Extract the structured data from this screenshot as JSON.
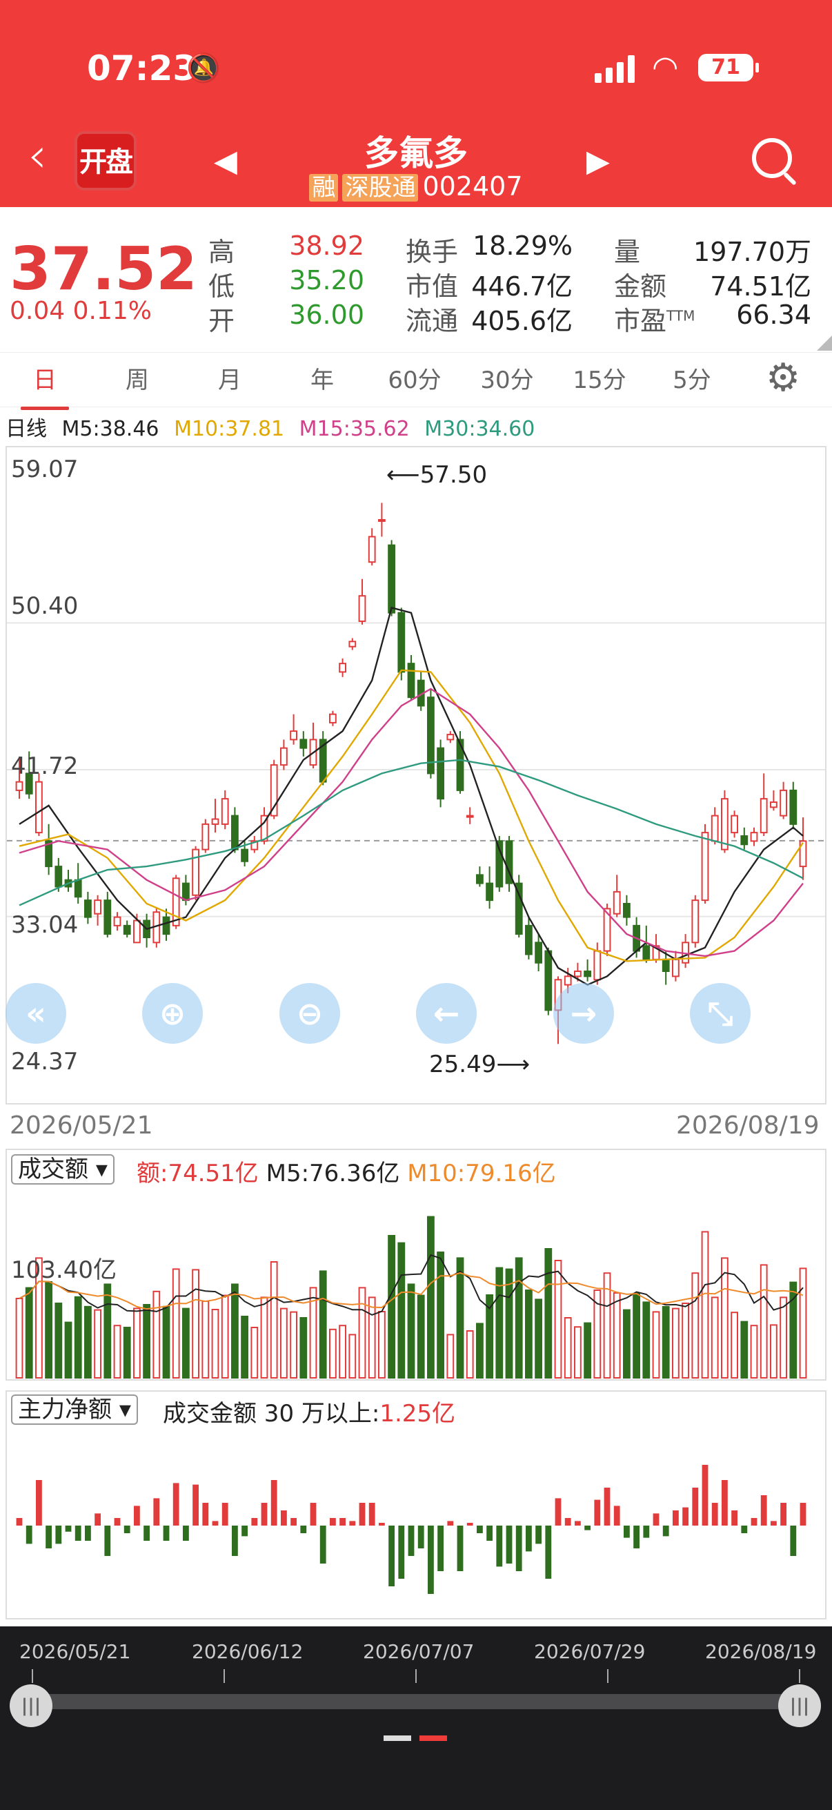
{
  "status_bar": {
    "time": "07:23",
    "battery": "71"
  },
  "header": {
    "kaipan_label": "开盘",
    "stock_name": "多氟多",
    "tag_margin": "融",
    "tag_connect": "深股通",
    "stock_code": "002407"
  },
  "quote": {
    "price": "37.52",
    "change": "0.04",
    "change_pct": "0.11%",
    "fields": [
      {
        "label": "高",
        "value": "38.92",
        "color": "#e13b3b"
      },
      {
        "label": "低",
        "value": "35.20",
        "color": "#2e9a2e"
      },
      {
        "label": "开",
        "value": "36.00",
        "color": "#2e9a2e"
      },
      {
        "label": "换手",
        "value": "18.29%"
      },
      {
        "label": "市值",
        "value": "446.7亿"
      },
      {
        "label": "流通",
        "value": "405.6亿"
      },
      {
        "label": "量",
        "value": "197.70万"
      },
      {
        "label": "金额",
        "value": "74.51亿"
      },
      {
        "label": "市盈",
        "sup": "TTM",
        "value": "66.34"
      }
    ]
  },
  "tabs": [
    "日",
    "周",
    "月",
    "年",
    "60分",
    "30分",
    "15分",
    "5分"
  ],
  "ma_legend": {
    "name": "日线",
    "m5": "M5:38.46",
    "m10": "M10:37.81",
    "m15": "M15:35.62",
    "m30": "M30:34.60",
    "colors": {
      "m5": "#222222",
      "m10": "#e0a800",
      "m15": "#d0408a",
      "m30": "#2e9a7e"
    }
  },
  "price_chart": {
    "y_labels": [
      "59.07",
      "50.40",
      "41.72",
      "33.04",
      "24.37"
    ],
    "high_annot": "57.50",
    "low_annot": "25.49",
    "start_date": "2026/05/21",
    "end_date": "2026/08/19",
    "controls": [
      "«",
      "⊕",
      "⊖",
      "←",
      "→",
      "⤡"
    ]
  },
  "volume_panel": {
    "selector": "成交额",
    "amount": "额:74.51亿",
    "m5": "M5:76.36亿",
    "m10": "M10:79.16亿",
    "y_label": "103.40亿"
  },
  "flow_panel": {
    "selector": "主力净额",
    "label": "成交金额 30 万以上:",
    "value": "1.25亿"
  },
  "scroller": {
    "dates": [
      "2026/05/21",
      "2026/06/12",
      "2026/07/07",
      "2026/07/29",
      "2026/08/19"
    ]
  },
  "chart_data": {
    "type": "candlestick",
    "y_range": [
      24.37,
      59.07
    ],
    "candles": [
      [
        40.5,
        41.0,
        42.5,
        40.0
      ],
      [
        41.5,
        40.3,
        42.8,
        40.0
      ],
      [
        38.0,
        41.0,
        41.5,
        37.8
      ],
      [
        37.5,
        36.0,
        38.5,
        35.5
      ],
      [
        36.0,
        34.8,
        36.5,
        34.5
      ],
      [
        35.2,
        34.8,
        35.8,
        34.5
      ],
      [
        35.2,
        34.2,
        36.2,
        33.8
      ],
      [
        34.0,
        33.0,
        34.5,
        32.6
      ],
      [
        33.2,
        34.0,
        34.3,
        32.5
      ],
      [
        34.0,
        32.0,
        34.5,
        31.8
      ],
      [
        32.5,
        33.0,
        33.3,
        32.2
      ],
      [
        32.5,
        32.0,
        32.8,
        31.8
      ],
      [
        31.5,
        32.8,
        33.2,
        31.5
      ],
      [
        32.8,
        31.8,
        33.2,
        31.2
      ],
      [
        31.5,
        33.3,
        33.6,
        31.2
      ],
      [
        33.0,
        32.0,
        33.5,
        31.6
      ],
      [
        32.5,
        35.3,
        35.5,
        32.3
      ],
      [
        35.0,
        34.0,
        35.5,
        33.7
      ],
      [
        34.3,
        37.0,
        37.2,
        34.0
      ],
      [
        37.0,
        38.5,
        38.8,
        36.8
      ],
      [
        38.5,
        38.8,
        40.0,
        38.0
      ],
      [
        38.5,
        40.0,
        40.5,
        38.2
      ],
      [
        39.0,
        37.0,
        39.5,
        36.8
      ],
      [
        37.0,
        36.3,
        37.5,
        36.0
      ],
      [
        37.0,
        37.5,
        37.8,
        36.8
      ],
      [
        37.5,
        39.0,
        39.5,
        37.3
      ],
      [
        39.0,
        42.0,
        42.3,
        38.8
      ],
      [
        42.0,
        43.0,
        43.5,
        41.7
      ],
      [
        43.5,
        44.0,
        45.0,
        43.2
      ],
      [
        43.5,
        43.0,
        44.0,
        42.5
      ],
      [
        42.0,
        43.5,
        44.5,
        41.8
      ],
      [
        43.5,
        41.0,
        44.0,
        40.8
      ],
      [
        44.5,
        45.0,
        45.2,
        44.3
      ],
      [
        47.5,
        48.0,
        48.3,
        47.2
      ],
      [
        49.0,
        49.3,
        49.5,
        48.8
      ],
      [
        50.5,
        52.0,
        53.0,
        50.3
      ],
      [
        54.0,
        55.5,
        56.0,
        53.8
      ],
      [
        56.5,
        56.5,
        57.5,
        55.5
      ],
      [
        55.0,
        51.0,
        55.3,
        50.8
      ],
      [
        51.0,
        47.5,
        51.3,
        47.0
      ],
      [
        48.0,
        46.0,
        48.5,
        45.8
      ],
      [
        47.0,
        45.5,
        47.5,
        45.2
      ],
      [
        46.0,
        41.5,
        46.5,
        41.2
      ],
      [
        43.0,
        40.0,
        43.5,
        39.5
      ],
      [
        43.5,
        43.8,
        44.0,
        43.3
      ],
      [
        43.5,
        40.5,
        44.0,
        40.3
      ],
      [
        39.0,
        39.0,
        39.5,
        38.5
      ],
      [
        35.5,
        35.0,
        36.0,
        34.8
      ],
      [
        35.0,
        34.0,
        36.0,
        33.5
      ],
      [
        37.5,
        34.8,
        37.8,
        34.5
      ],
      [
        37.5,
        35.0,
        37.8,
        34.5
      ],
      [
        35.0,
        32.0,
        35.5,
        31.8
      ],
      [
        32.5,
        30.8,
        33.0,
        30.5
      ],
      [
        31.5,
        30.3,
        32.0,
        29.8
      ],
      [
        31.0,
        27.5,
        31.2,
        27.2
      ],
      [
        27.5,
        29.3,
        29.5,
        25.5
      ],
      [
        29.0,
        29.5,
        30.0,
        28.5
      ],
      [
        29.5,
        29.8,
        30.3,
        29.2
      ],
      [
        29.8,
        29.5,
        30.5,
        29.2
      ],
      [
        29.3,
        31.0,
        31.5,
        29.0
      ],
      [
        31.0,
        33.5,
        33.8,
        30.7
      ],
      [
        33.2,
        34.5,
        35.5,
        33.0
      ],
      [
        33.8,
        33.0,
        34.3,
        32.5
      ],
      [
        32.5,
        31.0,
        33.0,
        30.6
      ],
      [
        31.3,
        30.5,
        32.5,
        30.3
      ],
      [
        30.5,
        31.3,
        32.0,
        30.3
      ],
      [
        30.5,
        29.8,
        31.0,
        29.0
      ],
      [
        29.5,
        30.5,
        31.0,
        29.2
      ],
      [
        30.3,
        31.5,
        32.0,
        30.0
      ],
      [
        31.5,
        34.0,
        34.3,
        31.2
      ],
      [
        34.0,
        38.0,
        38.5,
        33.8
      ],
      [
        37.5,
        39.0,
        39.5,
        37.3
      ],
      [
        37.0,
        40.0,
        40.5,
        36.8
      ],
      [
        38.0,
        39.0,
        39.3,
        37.7
      ],
      [
        37.8,
        37.3,
        38.3,
        37.0
      ],
      [
        37.5,
        38.0,
        38.3,
        37.2
      ],
      [
        38.0,
        40.0,
        41.5,
        37.8
      ],
      [
        39.5,
        39.8,
        40.5,
        39.3
      ],
      [
        39.0,
        40.5,
        41.0,
        38.8
      ],
      [
        40.5,
        38.5,
        41.0,
        38.2
      ],
      [
        36.0,
        37.5,
        38.9,
        35.2
      ]
    ],
    "ma_series": {
      "M5": [
        [
          0,
          38.5
        ],
        [
          3,
          39.6
        ],
        [
          6,
          37.1
        ],
        [
          10,
          34.0
        ],
        [
          13,
          32.3
        ],
        [
          17,
          33.0
        ],
        [
          21,
          36.5
        ],
        [
          25,
          38.6
        ],
        [
          29,
          42.3
        ],
        [
          33,
          44.0
        ],
        [
          36,
          47.0
        ],
        [
          38,
          51.3
        ],
        [
          40,
          51.0
        ],
        [
          42,
          47.0
        ],
        [
          46,
          42.0
        ],
        [
          49,
          37.0
        ],
        [
          52,
          33.0
        ],
        [
          55,
          30.0
        ],
        [
          58,
          29.0
        ],
        [
          60,
          29.5
        ],
        [
          64,
          31.5
        ],
        [
          67,
          30.5
        ],
        [
          70,
          31.2
        ],
        [
          73,
          34.5
        ],
        [
          76,
          37.0
        ],
        [
          79,
          38.3
        ],
        [
          80,
          37.8
        ]
      ],
      "M10": [
        [
          0,
          37.2
        ],
        [
          5,
          37.9
        ],
        [
          9,
          36.5
        ],
        [
          13,
          33.8
        ],
        [
          17,
          32.8
        ],
        [
          21,
          34.0
        ],
        [
          25,
          36.5
        ],
        [
          29,
          39.5
        ],
        [
          33,
          42.5
        ],
        [
          36,
          45.0
        ],
        [
          39,
          47.6
        ],
        [
          42,
          47.5
        ],
        [
          46,
          44.5
        ],
        [
          49,
          41.5
        ],
        [
          52,
          37.5
        ],
        [
          55,
          34.0
        ],
        [
          58,
          31.2
        ],
        [
          62,
          30.4
        ],
        [
          66,
          30.5
        ],
        [
          70,
          30.6
        ],
        [
          73,
          31.8
        ],
        [
          77,
          34.8
        ],
        [
          80,
          37.4
        ]
      ],
      "M15": [
        [
          0,
          36.8
        ],
        [
          4,
          37.5
        ],
        [
          9,
          37.0
        ],
        [
          13,
          35.2
        ],
        [
          17,
          34.0
        ],
        [
          21,
          34.6
        ],
        [
          25,
          36.0
        ],
        [
          29,
          38.5
        ],
        [
          33,
          41.0
        ],
        [
          36,
          43.5
        ],
        [
          39,
          45.5
        ],
        [
          42,
          46.5
        ],
        [
          46,
          45.0
        ],
        [
          49,
          43.0
        ],
        [
          52,
          40.5
        ],
        [
          55,
          37.5
        ],
        [
          58,
          34.5
        ],
        [
          62,
          32.0
        ],
        [
          66,
          31.0
        ],
        [
          70,
          30.7
        ],
        [
          73,
          31.0
        ],
        [
          77,
          32.8
        ],
        [
          80,
          35.0
        ]
      ],
      "M30": [
        [
          0,
          33.7
        ],
        [
          5,
          35.0
        ],
        [
          9,
          35.8
        ],
        [
          13,
          36.0
        ],
        [
          17,
          36.4
        ],
        [
          21,
          36.9
        ],
        [
          25,
          37.6
        ],
        [
          29,
          39.0
        ],
        [
          33,
          40.5
        ],
        [
          37,
          41.5
        ],
        [
          41,
          42.1
        ],
        [
          45,
          42.3
        ],
        [
          49,
          41.9
        ],
        [
          53,
          41.1
        ],
        [
          57,
          40.2
        ],
        [
          61,
          39.4
        ],
        [
          65,
          38.5
        ],
        [
          69,
          37.8
        ],
        [
          73,
          37.2
        ],
        [
          77,
          36.2
        ],
        [
          80,
          35.3
        ]
      ]
    },
    "volume": [],
    "flow": []
  }
}
